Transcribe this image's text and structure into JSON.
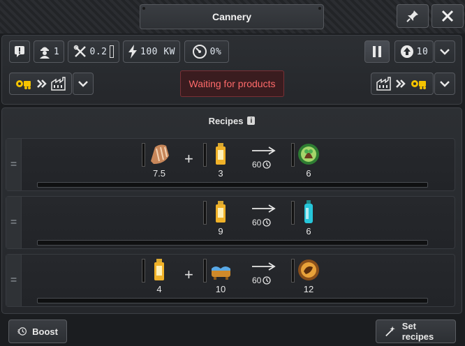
{
  "window": {
    "title": "Cannery"
  },
  "toolbar": {
    "workers_value": "1",
    "maintenance_value": "0.2",
    "power_value": "100 KW",
    "efficiency_value": "0%",
    "priority_value": "10"
  },
  "status": {
    "text": "Waiting for products"
  },
  "recipes": {
    "header": "Recipes",
    "info_badge": "i",
    "rows": [
      {
        "inputs": [
          {
            "icon": "fish-icon",
            "qty": "7.5"
          },
          {
            "icon": "jar-icon",
            "qty": "3"
          }
        ],
        "duration": "60",
        "output": {
          "icon": "canned-food-icon",
          "qty": "6"
        }
      },
      {
        "inputs": [
          {
            "icon": "jar-icon",
            "qty": "9"
          }
        ],
        "duration": "60",
        "output": {
          "icon": "bottle-icon",
          "qty": "6"
        }
      },
      {
        "inputs": [
          {
            "icon": "jar-icon",
            "qty": "4"
          },
          {
            "icon": "water-icon",
            "qty": "10"
          }
        ],
        "duration": "60",
        "output": {
          "icon": "preserve-icon",
          "qty": "12"
        }
      }
    ]
  },
  "footer": {
    "boost_label": "Boost",
    "set_recipes_label": "Set recipes"
  },
  "colors": {
    "status_text": "#ff6a6a",
    "status_bg": "#3a1c1f",
    "accent_yellow": "#f5c400"
  }
}
